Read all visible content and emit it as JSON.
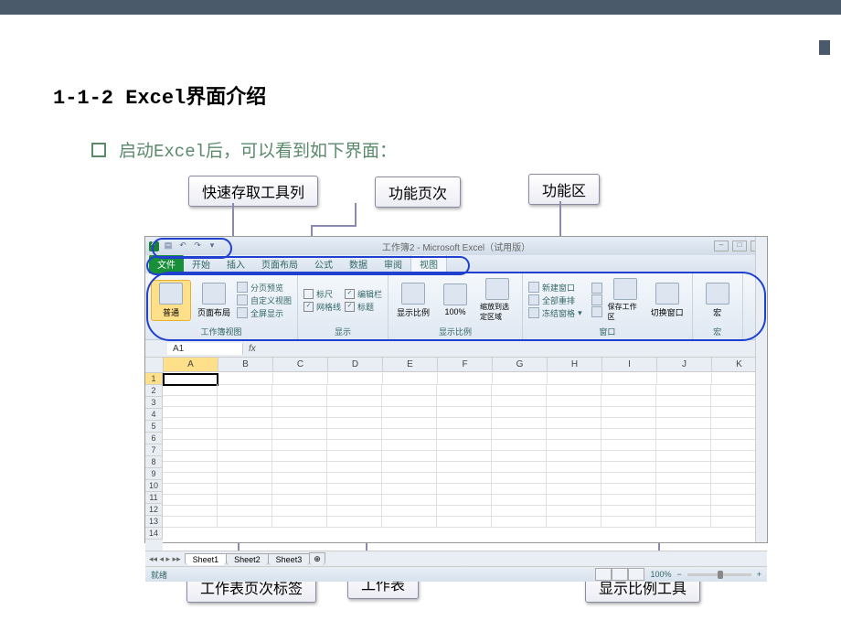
{
  "slide": {
    "title": "1-1-2 Excel界面介绍",
    "subtitle": "启动Excel后，可以看到如下界面："
  },
  "callouts": {
    "qat": "快速存取工具列",
    "tabs": "功能页次",
    "ribbon": "功能区",
    "sheet_tabs": "工作表页次标签",
    "worksheet": "工作表",
    "zoom": "显示比例工具"
  },
  "excel": {
    "title": "工作簿2 - Microsoft Excel（试用版）",
    "tabs": {
      "file": "文件",
      "home": "开始",
      "insert": "插入",
      "layout": "页面布局",
      "formula": "公式",
      "data": "数据",
      "review": "审阅",
      "view": "视图"
    },
    "ribbon": {
      "group1_label": "工作簿视图",
      "normal": "普通",
      "page_layout": "页面布局",
      "page_break": "分页预览",
      "custom_view": "自定义视图",
      "full_screen": "全屏显示",
      "group2_label": "显示",
      "ruler": "标尺",
      "gridlines": "网格线",
      "formula_bar": "编辑栏",
      "headings": "标题",
      "group3_label": "显示比例",
      "zoom": "显示比例",
      "hundred": "100%",
      "zoom_selection": "缩放到选定区域",
      "group4_label": "窗口",
      "new_window": "新建窗口",
      "arrange": "全部重排",
      "freeze": "冻结窗格",
      "save_ws": "保存工作区",
      "switch": "切换窗口",
      "macro_label": "宏",
      "macro": "宏"
    },
    "namebox": "A1",
    "fx": "fx",
    "columns": [
      "A",
      "B",
      "C",
      "D",
      "E",
      "F",
      "G",
      "H",
      "I",
      "J",
      "K"
    ],
    "rows": [
      "1",
      "2",
      "3",
      "4",
      "5",
      "6",
      "7",
      "8",
      "9",
      "10",
      "11",
      "12",
      "13",
      "14"
    ],
    "sheets": {
      "s1": "Sheet1",
      "s2": "Sheet2",
      "s3": "Sheet3"
    },
    "status": {
      "ready": "就绪",
      "zoom_value": "100%",
      "minus": "−",
      "plus": "+"
    }
  }
}
